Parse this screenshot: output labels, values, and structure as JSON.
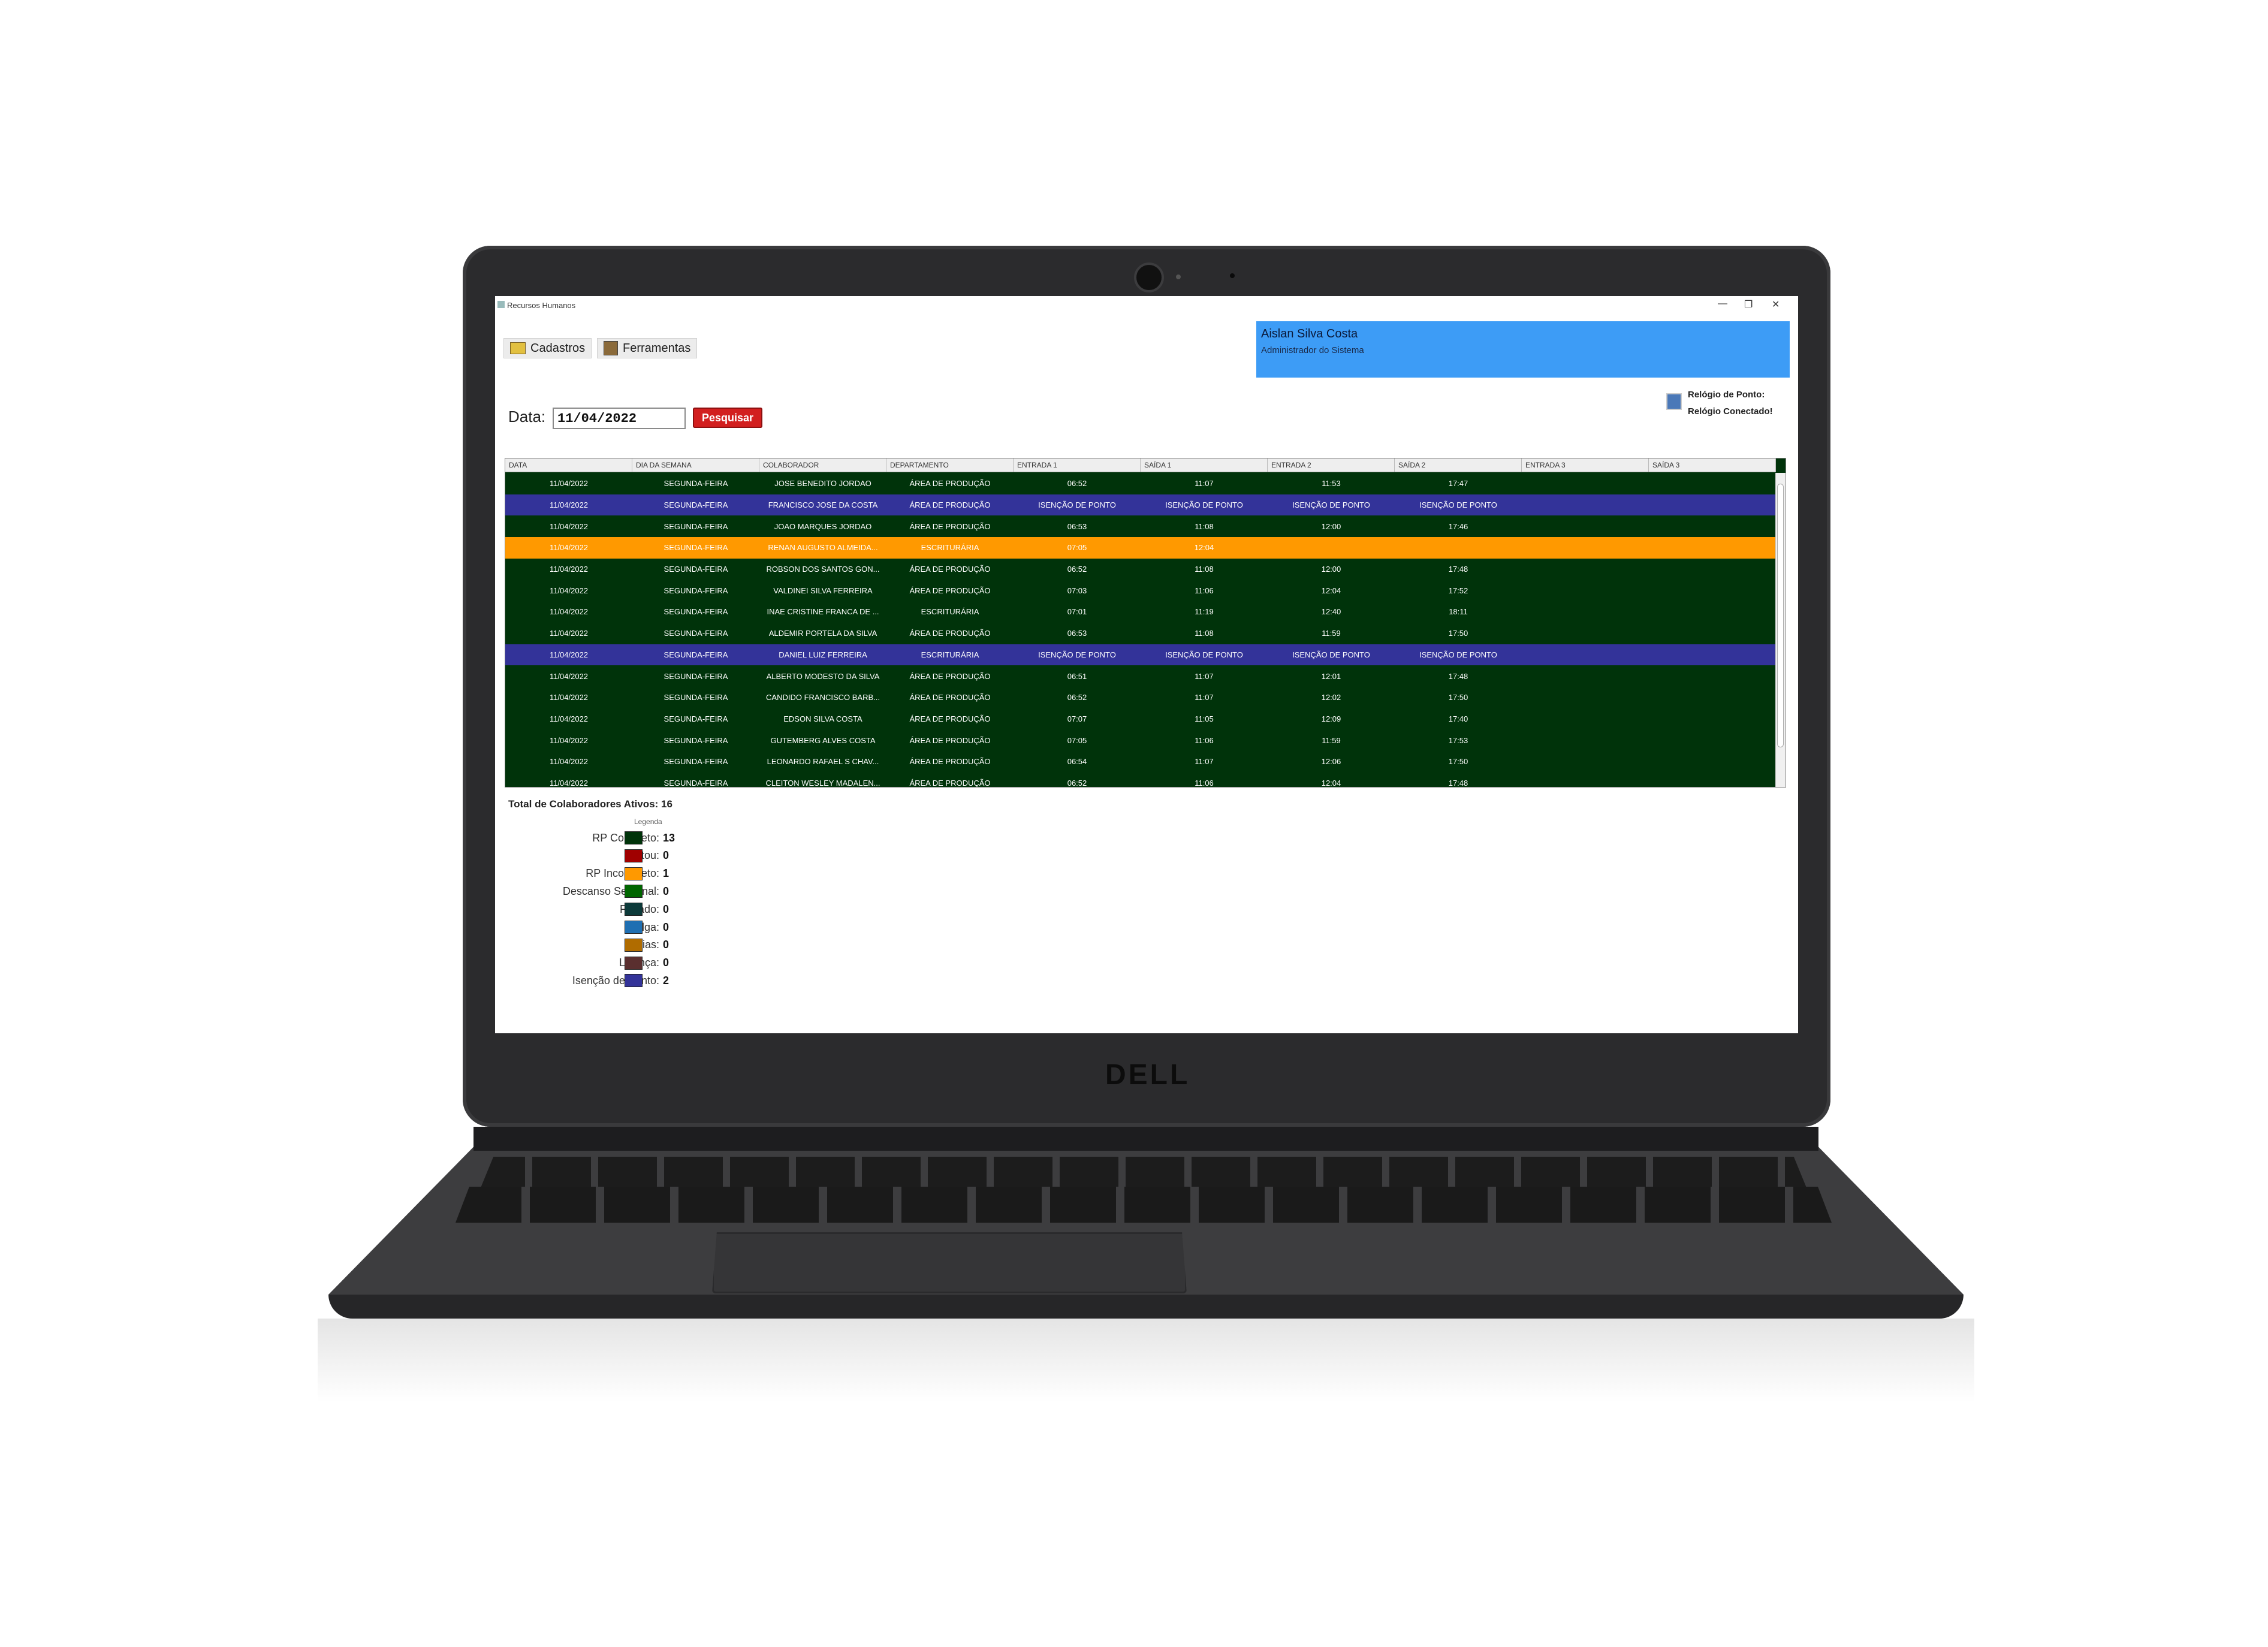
{
  "window": {
    "title": "Recursos Humanos",
    "controls": [
      "—",
      "❐",
      "✕"
    ]
  },
  "menu": {
    "cadastros": "Cadastros",
    "ferramentas": "Ferramentas"
  },
  "user": {
    "name": "Aislan Silva Costa",
    "role": "Administrador do Sistema"
  },
  "clock": {
    "label": "Relógio de Ponto:",
    "status": "Relógio Conectado!"
  },
  "search": {
    "label": "Data:",
    "date": "11/04/2022",
    "button": "Pesquisar"
  },
  "table": {
    "columns": [
      "DATA",
      "DIA DA SEMANA",
      "COLABORADOR",
      "DEPARTAMENTO",
      "ENTRADA 1",
      "SAÍDA 1",
      "ENTRADA 2",
      "SAÍDA 2",
      "ENTRADA 3",
      "SAÍDA 3"
    ],
    "rows": [
      {
        "status": "completo",
        "cells": [
          "11/04/2022",
          "SEGUNDA-FEIRA",
          "JOSE BENEDITO JORDAO",
          "ÁREA DE PRODUÇÃO",
          "06:52",
          "11:07",
          "11:53",
          "17:47",
          "",
          ""
        ]
      },
      {
        "status": "isencao",
        "cells": [
          "11/04/2022",
          "SEGUNDA-FEIRA",
          "FRANCISCO JOSE DA COSTA",
          "ÁREA DE PRODUÇÃO",
          "ISENÇÃO DE PONTO",
          "ISENÇÃO DE PONTO",
          "ISENÇÃO DE PONTO",
          "ISENÇÃO DE PONTO",
          "",
          ""
        ]
      },
      {
        "status": "completo",
        "cells": [
          "11/04/2022",
          "SEGUNDA-FEIRA",
          "JOAO MARQUES JORDAO",
          "ÁREA DE PRODUÇÃO",
          "06:53",
          "11:08",
          "12:00",
          "17:46",
          "",
          ""
        ]
      },
      {
        "status": "incompleto",
        "cells": [
          "11/04/2022",
          "SEGUNDA-FEIRA",
          "RENAN AUGUSTO ALMEIDA...",
          "ESCRITURÁRIA",
          "07:05",
          "12:04",
          "",
          "",
          "",
          ""
        ]
      },
      {
        "status": "completo",
        "cells": [
          "11/04/2022",
          "SEGUNDA-FEIRA",
          "ROBSON DOS SANTOS GON...",
          "ÁREA DE PRODUÇÃO",
          "06:52",
          "11:08",
          "12:00",
          "17:48",
          "",
          ""
        ]
      },
      {
        "status": "completo",
        "cells": [
          "11/04/2022",
          "SEGUNDA-FEIRA",
          "VALDINEI SILVA FERREIRA",
          "ÁREA DE PRODUÇÃO",
          "07:03",
          "11:06",
          "12:04",
          "17:52",
          "",
          ""
        ]
      },
      {
        "status": "completo",
        "cells": [
          "11/04/2022",
          "SEGUNDA-FEIRA",
          "INAE CRISTINE FRANCA DE ...",
          "ESCRITURÁRIA",
          "07:01",
          "11:19",
          "12:40",
          "18:11",
          "",
          ""
        ]
      },
      {
        "status": "completo",
        "cells": [
          "11/04/2022",
          "SEGUNDA-FEIRA",
          "ALDEMIR PORTELA DA SILVA",
          "ÁREA DE PRODUÇÃO",
          "06:53",
          "11:08",
          "11:59",
          "17:50",
          "",
          ""
        ]
      },
      {
        "status": "isencao",
        "cells": [
          "11/04/2022",
          "SEGUNDA-FEIRA",
          "DANIEL LUIZ FERREIRA",
          "ESCRITURÁRIA",
          "ISENÇÃO DE PONTO",
          "ISENÇÃO DE PONTO",
          "ISENÇÃO DE PONTO",
          "ISENÇÃO DE PONTO",
          "",
          ""
        ]
      },
      {
        "status": "completo",
        "cells": [
          "11/04/2022",
          "SEGUNDA-FEIRA",
          "ALBERTO MODESTO DA SILVA",
          "ÁREA DE PRODUÇÃO",
          "06:51",
          "11:07",
          "12:01",
          "17:48",
          "",
          ""
        ]
      },
      {
        "status": "completo",
        "cells": [
          "11/04/2022",
          "SEGUNDA-FEIRA",
          "CANDIDO FRANCISCO BARB...",
          "ÁREA DE PRODUÇÃO",
          "06:52",
          "11:07",
          "12:02",
          "17:50",
          "",
          ""
        ]
      },
      {
        "status": "completo",
        "cells": [
          "11/04/2022",
          "SEGUNDA-FEIRA",
          "EDSON SILVA COSTA",
          "ÁREA DE PRODUÇÃO",
          "07:07",
          "11:05",
          "12:09",
          "17:40",
          "",
          ""
        ]
      },
      {
        "status": "completo",
        "cells": [
          "11/04/2022",
          "SEGUNDA-FEIRA",
          "GUTEMBERG ALVES COSTA",
          "ÁREA DE PRODUÇÃO",
          "07:05",
          "11:06",
          "11:59",
          "17:53",
          "",
          ""
        ]
      },
      {
        "status": "completo",
        "cells": [
          "11/04/2022",
          "SEGUNDA-FEIRA",
          "LEONARDO RAFAEL S CHAV...",
          "ÁREA DE PRODUÇÃO",
          "06:54",
          "11:07",
          "12:06",
          "17:50",
          "",
          ""
        ]
      },
      {
        "status": "completo",
        "cells": [
          "11/04/2022",
          "SEGUNDA-FEIRA",
          "CLEITON WESLEY MADALEN...",
          "ÁREA DE PRODUÇÃO",
          "06:52",
          "11:06",
          "12:04",
          "17:48",
          "",
          ""
        ]
      }
    ]
  },
  "row_colors": {
    "completo": "#00330a",
    "isencao": "#333399",
    "incompleto": "#ff9900"
  },
  "total": "Total de Colaboradores Ativos: 16",
  "legend": {
    "title": "Legenda",
    "items": [
      {
        "label": "RP Completo:",
        "count": "13",
        "color": "#00330a"
      },
      {
        "label": "Faltou:",
        "count": "0",
        "color": "#a00000"
      },
      {
        "label": "RP Incompleto:",
        "count": "1",
        "color": "#ff9900"
      },
      {
        "label": "Descanso Semanal:",
        "count": "0",
        "color": "#006600"
      },
      {
        "label": "Feriado:",
        "count": "0",
        "color": "#0d3a3a"
      },
      {
        "label": "Folga:",
        "count": "0",
        "color": "#1f6fb2"
      },
      {
        "label": "Férias:",
        "count": "0",
        "color": "#b06c00"
      },
      {
        "label": "Licença:",
        "count": "0",
        "color": "#5a2f2f"
      },
      {
        "label": "Isenção de Ponto:",
        "count": "2",
        "color": "#333399"
      }
    ]
  },
  "brand": "DELL"
}
